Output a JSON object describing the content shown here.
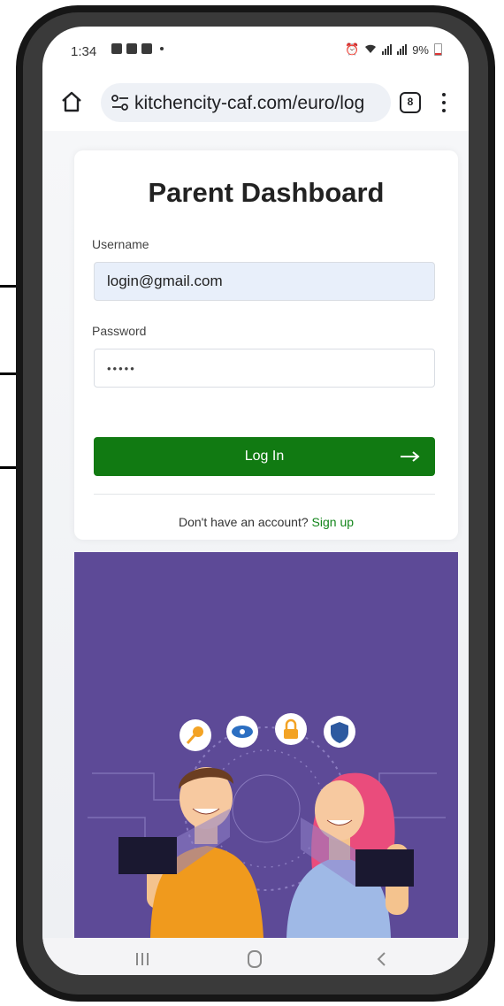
{
  "status_bar": {
    "time": "1:34",
    "battery": "9%"
  },
  "browser": {
    "url": "kitchencity-caf.com/euro/log",
    "tab_count": "8",
    "icons": [
      "home-icon",
      "tune-icon",
      "tabs-icon",
      "more-vert-icon"
    ]
  },
  "login": {
    "title": "Parent Dashboard",
    "username_label": "Username",
    "username_value": "login@gmail.com",
    "password_label": "Password",
    "password_value": "•••••",
    "button_label": "Log In",
    "signup_prompt": "Don't have an account?",
    "signup_link": "Sign up"
  },
  "nav": {
    "icons": [
      "recents-icon",
      "home-icon",
      "back-icon"
    ]
  },
  "colors": {
    "primary_green": "#117a12",
    "link_green": "#12851a",
    "promo_purple": "#5d4a97",
    "input_fill": "#e8effa"
  }
}
